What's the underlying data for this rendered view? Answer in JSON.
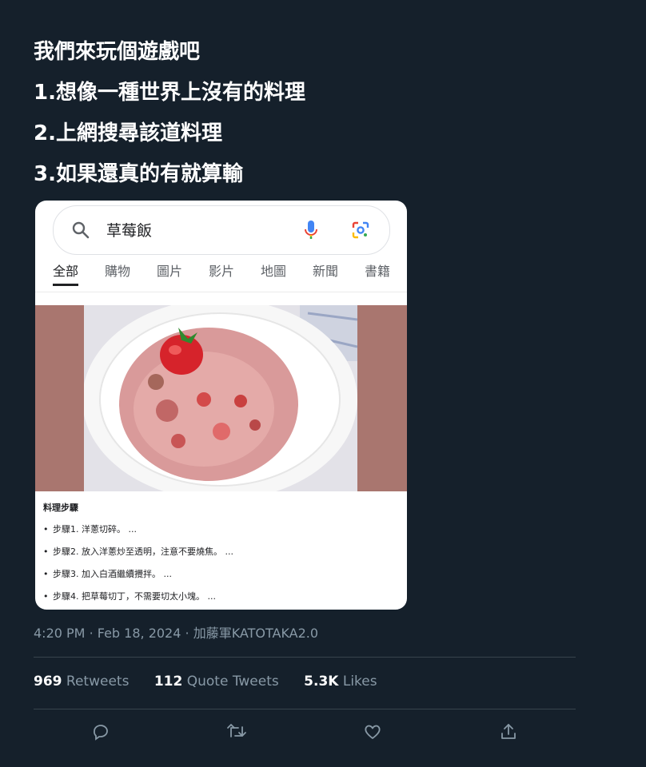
{
  "tweet": {
    "lines": [
      "我們來玩個遊戲吧",
      "1.想像一種世界上沒有的料理",
      "2.上網搜尋該道料理",
      "3.如果還真的有就算輸"
    ]
  },
  "search": {
    "query": "草莓飯",
    "tabs": [
      "全部",
      "購物",
      "圖片",
      "影片",
      "地圖",
      "新聞",
      "書籍"
    ],
    "active_tab": "全部"
  },
  "recipe": {
    "title": "料理步驟",
    "steps": [
      "步驟1. 洋蔥切碎。 ...",
      "步驟2. 放入洋蔥炒至透明，注意不要燒焦。 ...",
      "步驟3. 加入白酒繼續攪拌。 ...",
      "步驟4. 把草莓切丁，不需要切太小塊。 ..."
    ]
  },
  "meta": {
    "time": "4:20 PM",
    "date": "Feb 18, 2024",
    "source": "加藤軍KATOTAKA2.0",
    "separator": "·"
  },
  "stats": {
    "retweets_count": "969",
    "retweets_label": "Retweets",
    "quotes_count": "112",
    "quotes_label": "Quote Tweets",
    "likes_count": "5.3K",
    "likes_label": "Likes"
  },
  "colors": {
    "background": "#15202b",
    "muted_text": "#8899a6",
    "divider": "#38444d",
    "google_blue": "#4285f4",
    "google_red": "#ea4335",
    "google_yellow": "#fbbc05",
    "google_green": "#34a853"
  },
  "icons": {
    "search": "search-icon",
    "mic": "mic-icon",
    "lens": "lens-icon",
    "reply": "reply-icon",
    "retweet": "retweet-icon",
    "like": "heart-icon",
    "share": "share-icon"
  }
}
